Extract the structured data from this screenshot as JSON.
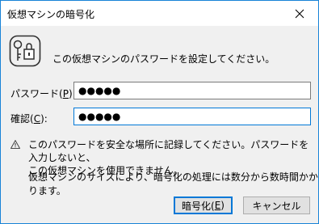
{
  "window": {
    "title": "仮想マシンの暗号化"
  },
  "header": {
    "message": "この仮想マシンのパスワードを設定してください。",
    "icon": "key-lock-icon"
  },
  "fields": {
    "password": {
      "label_before": "パスワード(",
      "mnemonic": "P",
      "label_after": "):",
      "masked_value": "●●●●●"
    },
    "confirm": {
      "label_before": "確認(",
      "mnemonic": "C",
      "label_after": "):",
      "masked_value": "●●●●●"
    }
  },
  "warning": {
    "icon": "warning-icon",
    "line1": "このパスワードを安全な場所に記録してください。パスワードを入力しないと、",
    "line2": "この仮想マシンを使用できません。"
  },
  "info": "仮想マシンのサイズにより、暗号化の処理には数分から数時間かかります。",
  "buttons": {
    "encrypt": {
      "label_before": "暗号化(",
      "mnemonic": "E",
      "label_after": ")"
    },
    "cancel": {
      "label": "キャンセル"
    }
  },
  "colors": {
    "accent": "#0078d7",
    "window_border": "#1883d7",
    "dialog_bg": "#f0f0f0"
  }
}
